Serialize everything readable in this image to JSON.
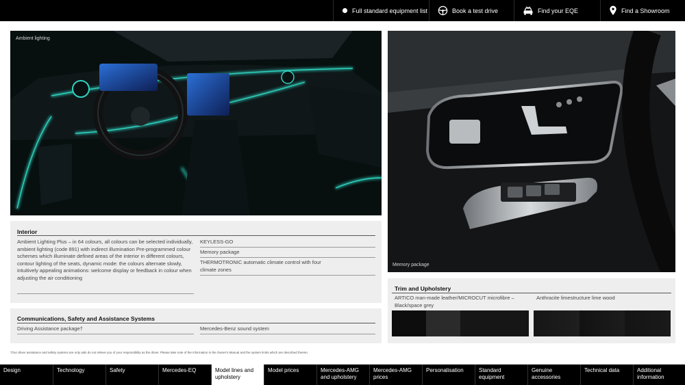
{
  "topbar": {
    "items": [
      {
        "label": "Full standard equipment list",
        "icon": "dot-icon"
      },
      {
        "label": "Book a test drive",
        "icon": "steering-wheel-icon"
      },
      {
        "label": "Find your EQE",
        "icon": "car-icon"
      },
      {
        "label": "Find a Showroom",
        "icon": "location-pin-icon"
      }
    ]
  },
  "images": {
    "ambient_caption": "Ambient lighting",
    "memory_caption": "Memory package"
  },
  "interior": {
    "title": "Interior",
    "left_text": "Ambient Lighting Plus – in 64 colours, all colours can be selected individually, ambient lighting (code 891) with indirect illumination Pre-programmed colour schemes which illuminate defined areas of the interior in different colours, contour lighting of the seats, dynamic mode: the colours alternate slowly, intuitively appealing animations: welcome display or feedback in colour when adjusting the air conditioning",
    "right_items": [
      "KEYLESS-GO",
      "Memory package",
      "THERMOTRONIC automatic climate control with four climate zones"
    ]
  },
  "comms": {
    "title": "Communications, Safety and Assistance Systems",
    "left_item": "Driving Assistance package†",
    "right_item": "Mercedes-Benz sound system"
  },
  "trim": {
    "title": "Trim and Upholstery",
    "left_item": "ARTICO man-made leather/MICROCUT microfibre – Black/space grey",
    "right_item": "Anthracite limestructure lime wood"
  },
  "disclaimer": "†Our driver assistance and safety systems are only aids do not relieve you of your responsibility as the driver. Please take note of the information in the Owner's Manual and the system limits which are described therein.",
  "bottomnav": {
    "items": [
      {
        "label": "Design",
        "active": false
      },
      {
        "label": "Technology",
        "active": false
      },
      {
        "label": "Safety",
        "active": false
      },
      {
        "label": "Mercedes-EQ",
        "active": false
      },
      {
        "label": "Model lines and upholstery",
        "active": true
      },
      {
        "label": "Model prices",
        "active": false
      },
      {
        "label": "Mercedes-AMG and upholstery",
        "active": false
      },
      {
        "label": "Mercedes-AMG prices",
        "active": false
      },
      {
        "label": "Personalisation",
        "active": false
      },
      {
        "label": "Standard equipment",
        "active": false
      },
      {
        "label": "Genuine accessories",
        "active": false
      },
      {
        "label": "Technical data",
        "active": false
      },
      {
        "label": "Additional information",
        "active": false
      }
    ]
  },
  "colors": {
    "ambient_glow": "#2fd3c0",
    "topbar_bg": "#000000",
    "panel_bg": "#eeeeee"
  }
}
